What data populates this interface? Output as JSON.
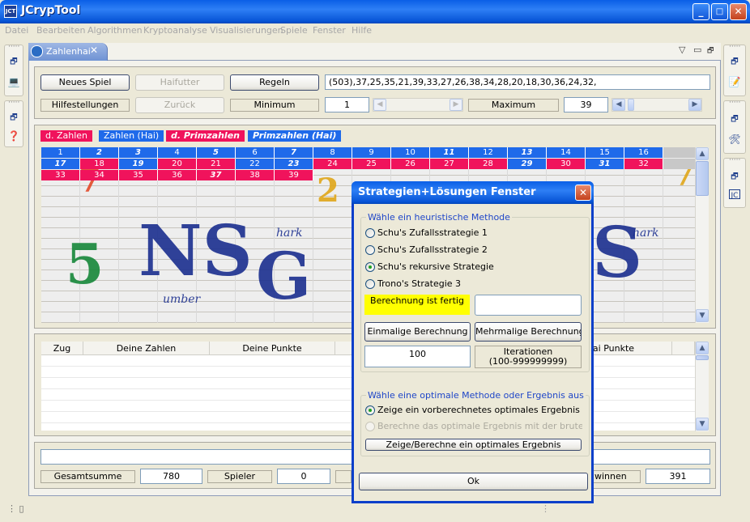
{
  "window": {
    "title": "JCrypTool",
    "icon_text": "JCT",
    "min_label": "_",
    "max_label": "□",
    "close_label": "✕"
  },
  "menu": [
    "Datei",
    "Bearbeiten",
    "Algorithmen",
    "Kryptoanalyse",
    "Visualisierungen",
    "Spiele",
    "Fenster",
    "Hilfe"
  ],
  "tab": {
    "label": "Zahlenhai",
    "close": "✕"
  },
  "view_controls": {
    "menu": "▽",
    "minimize": "▭",
    "maximize": "🗗"
  },
  "controls": {
    "new_game": "Neues Spiel",
    "shark_food": "Haifutter",
    "rules": "Regeln",
    "sequence": "(503),37,25,35,21,39,33,27,26,38,34,28,20,18,30,36,24,32,",
    "hints": "Hilfestellungen",
    "back": "Zurück",
    "minimum_label": "Minimum",
    "minimum_value": "1",
    "maximum_label": "Maximum",
    "maximum_value": "39",
    "spin_left": "◀",
    "spin_right": "▶"
  },
  "legend": [
    "d. Zahlen",
    "Zahlen (Hai)",
    "d. Primzahlen",
    "Primzahlen (Hai)"
  ],
  "board": {
    "rows": [
      [
        [
          "1",
          "b",
          false
        ],
        [
          "2",
          "b",
          true
        ],
        [
          "3",
          "b",
          true
        ],
        [
          "4",
          "b",
          false
        ],
        [
          "5",
          "b",
          true
        ],
        [
          "6",
          "b",
          false
        ],
        [
          "7",
          "b",
          true
        ],
        [
          "8",
          "b",
          false
        ],
        [
          "9",
          "b",
          false
        ],
        [
          "10",
          "b",
          false
        ],
        [
          "11",
          "b",
          true
        ],
        [
          "12",
          "b",
          false
        ],
        [
          "13",
          "b",
          true
        ],
        [
          "14",
          "b",
          false
        ],
        [
          "15",
          "b",
          false
        ],
        [
          "16",
          "b",
          false
        ]
      ],
      [
        [
          "17",
          "b",
          true
        ],
        [
          "18",
          "r",
          false
        ],
        [
          "19",
          "b",
          true
        ],
        [
          "20",
          "r",
          false
        ],
        [
          "21",
          "r",
          false
        ],
        [
          "22",
          "b",
          false
        ],
        [
          "23",
          "b",
          true
        ],
        [
          "24",
          "r",
          false
        ],
        [
          "25",
          "r",
          false
        ],
        [
          "26",
          "r",
          false
        ],
        [
          "27",
          "r",
          false
        ],
        [
          "28",
          "r",
          false
        ],
        [
          "29",
          "b",
          true
        ],
        [
          "30",
          "r",
          false
        ],
        [
          "31",
          "b",
          true
        ],
        [
          "32",
          "r",
          false
        ]
      ],
      [
        [
          "33",
          "r",
          false
        ],
        [
          "34",
          "r",
          false
        ],
        [
          "35",
          "r",
          false
        ],
        [
          "36",
          "r",
          false
        ],
        [
          "37",
          "r",
          true
        ],
        [
          "38",
          "r",
          false
        ],
        [
          "39",
          "r",
          false
        ]
      ]
    ],
    "decor": {
      "hark": "hark",
      "umber": "umber"
    }
  },
  "table": {
    "headers": [
      "Zug",
      "Deine Zahlen",
      "Deine Punkte",
      "",
      "nhai Punkte"
    ]
  },
  "summary": {
    "total_label": "Gesamtsumme",
    "total_value": "780",
    "player_label": "Spieler",
    "player_value": "0",
    "win_label": "winnen",
    "win_value": "391"
  },
  "scroll": {
    "up": "▲",
    "down": "▼"
  },
  "dialog": {
    "title": "Strategien+Lösungen Fenster",
    "close": "✕",
    "heuristic_group": "Wähle ein heuristische Methode",
    "options": [
      "Schu's Zufallsstrategie 1",
      "Schu's Zufallsstrategie 2",
      "Schu's rekursive Strategie",
      "Trono's Strategie 3"
    ],
    "selected_option": 2,
    "status": "Berechnung ist fertig",
    "status_field": "",
    "single_calc": "Einmalige Berechnung",
    "multi_calc": "Mehrmalige Berechnung ...",
    "iterations_value": "100",
    "iterations_label_1": "Iterationen",
    "iterations_label_2": "(100-999999999)",
    "optimal_group": "Wähle eine optimale Methode oder Ergebnis aus",
    "optimal_opt1": "Zeige ein vorberechnetes optimales Ergebnis",
    "optimal_opt2": "Berechne das optimale Ergebnis mit der brute force Methode",
    "show_optimal": "Zeige/Berechne ein optimales Ergebnis",
    "ok": "Ok"
  },
  "colors": {
    "blue": "#1f6aea",
    "red": "#f0135c",
    "status_yellow": "#ffff00",
    "title_blue": "#0754d6"
  }
}
